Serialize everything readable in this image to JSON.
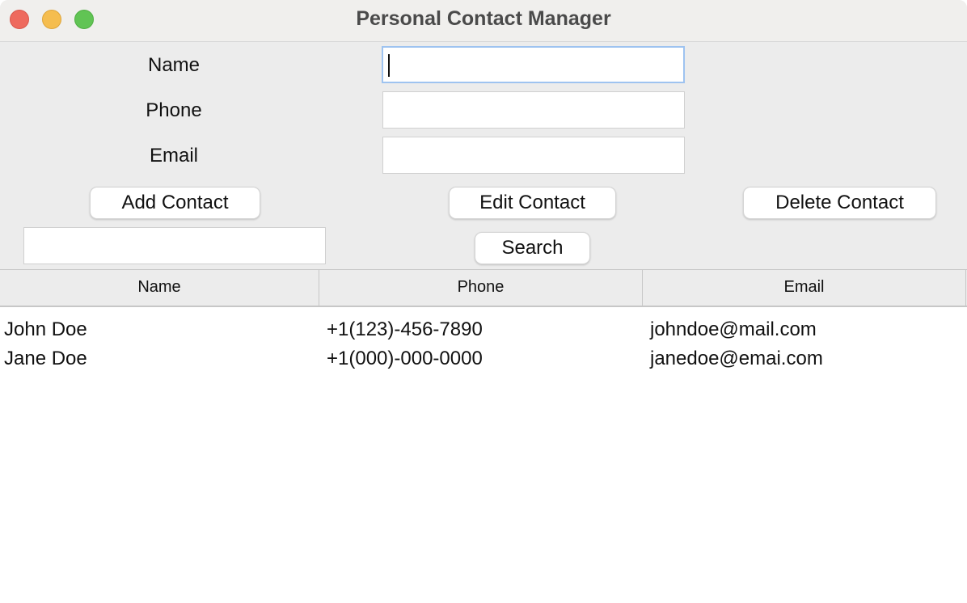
{
  "window": {
    "title": "Personal Contact Manager"
  },
  "form": {
    "name_label": "Name",
    "phone_label": "Phone",
    "email_label": "Email",
    "name_value": "",
    "phone_value": "",
    "email_value": ""
  },
  "actions": {
    "add_label": "Add Contact",
    "edit_label": "Edit Contact",
    "delete_label": "Delete Contact",
    "search_value": "",
    "search_label": "Search"
  },
  "table": {
    "columns": [
      "Name",
      "Phone",
      "Email"
    ],
    "rows": [
      [
        "John Doe",
        "+1(123)-456-7890",
        "johndoe@mail.com"
      ],
      [
        "Jane Doe",
        "+1(000)-000-0000",
        "janedoe@emai.com"
      ]
    ]
  },
  "colors": {
    "close": "#ee6a5e",
    "minimize": "#f5bd4f",
    "zoom": "#61c454",
    "focus_ring": "#9ec3f0"
  }
}
